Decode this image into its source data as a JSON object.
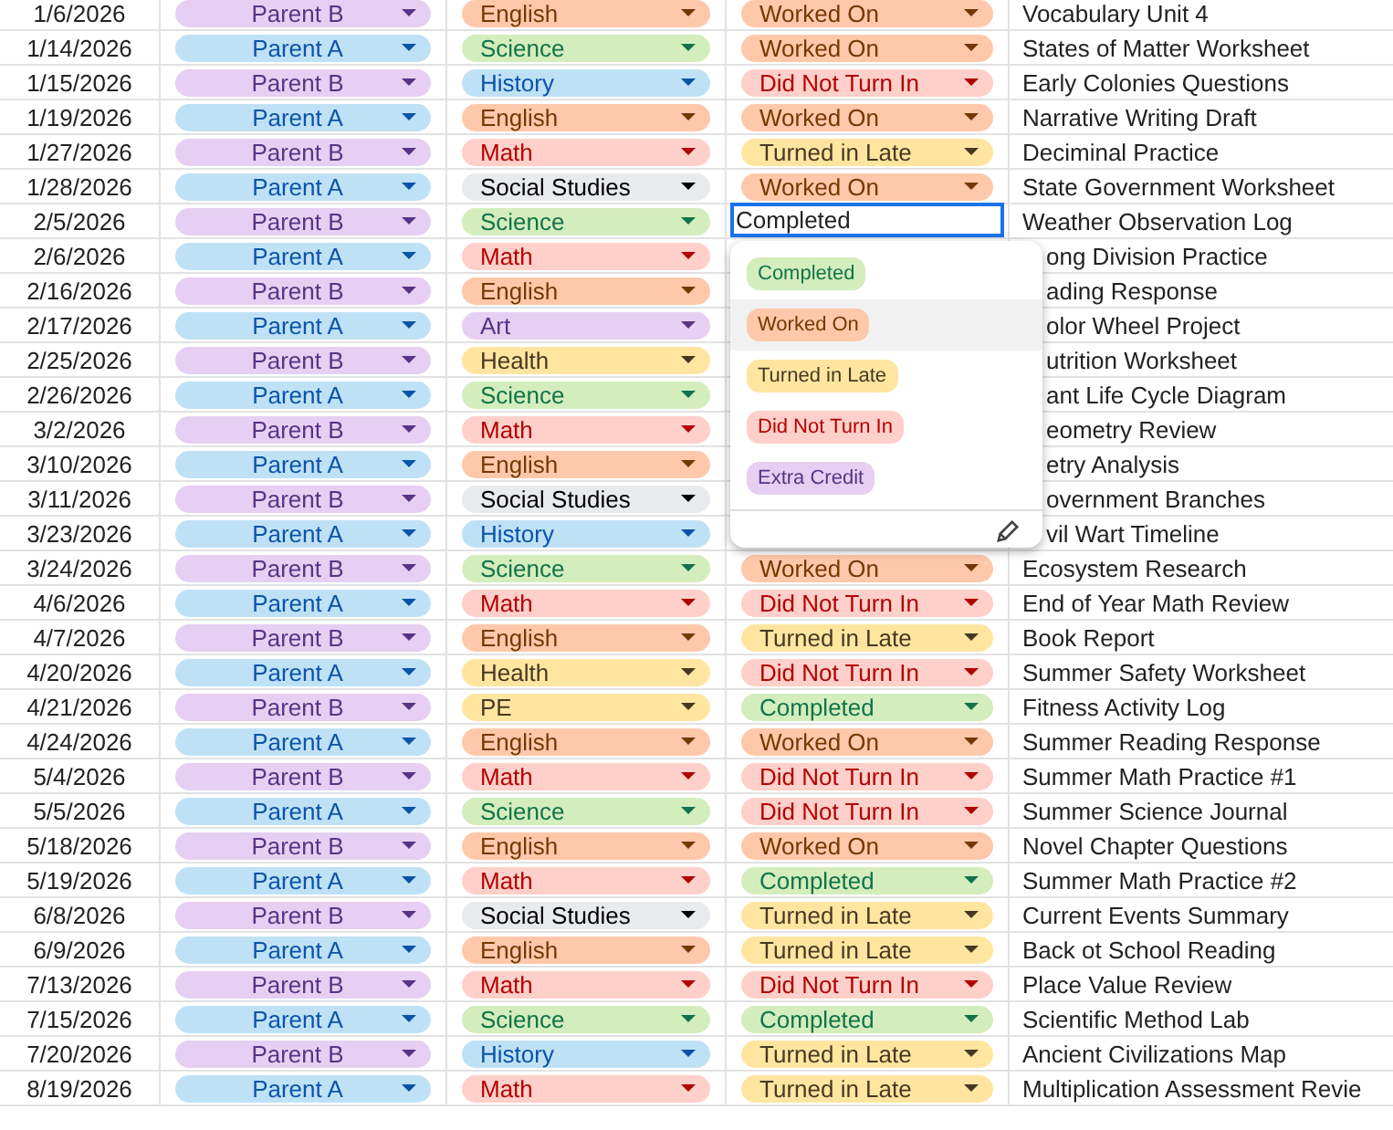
{
  "rows": [
    {
      "date": "1/6/2026",
      "parent": {
        "text": "Parent B",
        "color": "#e6cff2"
      },
      "subject": {
        "text": "English",
        "color": "#ffc8aa"
      },
      "status": {
        "kind": "chip",
        "text": "Worked On",
        "color": "#ffc8aa"
      },
      "title": "Vocabulary Unit 4"
    },
    {
      "date": "1/14/2026",
      "parent": {
        "text": "Parent A",
        "color": "#bfe1f6"
      },
      "subject": {
        "text": "Science",
        "color": "#d4edbc"
      },
      "status": {
        "kind": "chip",
        "text": "Worked On",
        "color": "#ffc8aa"
      },
      "title": "States of Matter Worksheet"
    },
    {
      "date": "1/15/2026",
      "parent": {
        "text": "Parent B",
        "color": "#e6cff2"
      },
      "subject": {
        "text": "History",
        "color": "#bfe1f6"
      },
      "status": {
        "kind": "chip",
        "text": "Did Not Turn In",
        "color": "#ffcfc9"
      },
      "title": "Early Colonies Questions"
    },
    {
      "date": "1/19/2026",
      "parent": {
        "text": "Parent A",
        "color": "#bfe1f6"
      },
      "subject": {
        "text": "English",
        "color": "#ffc8aa"
      },
      "status": {
        "kind": "chip",
        "text": "Worked On",
        "color": "#ffc8aa"
      },
      "title": "Narrative Writing Draft"
    },
    {
      "date": "1/27/2026",
      "parent": {
        "text": "Parent B",
        "color": "#e6cff2"
      },
      "subject": {
        "text": "Math",
        "color": "#ffcfc9"
      },
      "status": {
        "kind": "chip",
        "text": "Turned in Late",
        "color": "#ffe5a0"
      },
      "title": "Deciminal Practice"
    },
    {
      "date": "1/28/2026",
      "parent": {
        "text": "Parent A",
        "color": "#bfe1f6"
      },
      "subject": {
        "text": "Social Studies",
        "color": "#e8eaed"
      },
      "status": {
        "kind": "chip",
        "text": "Worked On",
        "color": "#ffc8aa"
      },
      "title": "State Government Worksheet"
    },
    {
      "date": "2/5/2026",
      "parent": {
        "text": "Parent B",
        "color": "#e6cff2"
      },
      "subject": {
        "text": "Science",
        "color": "#d4edbc"
      },
      "status": {
        "kind": "input",
        "text": "Completed"
      },
      "title": "Weather Observation Log"
    },
    {
      "date": "2/6/2026",
      "parent": {
        "text": "Parent A",
        "color": "#bfe1f6"
      },
      "subject": {
        "text": "Math",
        "color": "#ffcfc9"
      },
      "title": "ong Division Practice"
    },
    {
      "date": "2/16/2026",
      "parent": {
        "text": "Parent B",
        "color": "#e6cff2"
      },
      "subject": {
        "text": "English",
        "color": "#ffc8aa"
      },
      "title": "ading Response"
    },
    {
      "date": "2/17/2026",
      "parent": {
        "text": "Parent A",
        "color": "#bfe1f6"
      },
      "subject": {
        "text": "Art",
        "color": "#e6cff2"
      },
      "title": "olor Wheel Project"
    },
    {
      "date": "2/25/2026",
      "parent": {
        "text": "Parent B",
        "color": "#e6cff2"
      },
      "subject": {
        "text": "Health",
        "color": "#ffe5a0"
      },
      "title": "utrition Worksheet"
    },
    {
      "date": "2/26/2026",
      "parent": {
        "text": "Parent A",
        "color": "#bfe1f6"
      },
      "subject": {
        "text": "Science",
        "color": "#d4edbc"
      },
      "title": "ant Life Cycle Diagram"
    },
    {
      "date": "3/2/2026",
      "parent": {
        "text": "Parent B",
        "color": "#e6cff2"
      },
      "subject": {
        "text": "Math",
        "color": "#ffcfc9"
      },
      "title": "eometry Review"
    },
    {
      "date": "3/10/2026",
      "parent": {
        "text": "Parent A",
        "color": "#bfe1f6"
      },
      "subject": {
        "text": "English",
        "color": "#ffc8aa"
      },
      "title": "etry Analysis"
    },
    {
      "date": "3/11/2026",
      "parent": {
        "text": "Parent B",
        "color": "#e6cff2"
      },
      "subject": {
        "text": "Social Studies",
        "color": "#e8eaed"
      },
      "title": "overnment Branches"
    },
    {
      "date": "3/23/2026",
      "parent": {
        "text": "Parent A",
        "color": "#bfe1f6"
      },
      "subject": {
        "text": "History",
        "color": "#bfe1f6"
      },
      "title": "vil Wart Timeline"
    },
    {
      "date": "3/24/2026",
      "parent": {
        "text": "Parent B",
        "color": "#e6cff2"
      },
      "subject": {
        "text": "Science",
        "color": "#d4edbc"
      },
      "status": {
        "kind": "chip",
        "text": "Worked On",
        "color": "#ffc8aa"
      },
      "title": "Ecosystem Research"
    },
    {
      "date": "4/6/2026",
      "parent": {
        "text": "Parent A",
        "color": "#bfe1f6"
      },
      "subject": {
        "text": "Math",
        "color": "#ffcfc9"
      },
      "status": {
        "kind": "chip",
        "text": "Did Not Turn In",
        "color": "#ffcfc9"
      },
      "title": "End of Year Math Review"
    },
    {
      "date": "4/7/2026",
      "parent": {
        "text": "Parent B",
        "color": "#e6cff2"
      },
      "subject": {
        "text": "English",
        "color": "#ffc8aa"
      },
      "status": {
        "kind": "chip",
        "text": "Turned in Late",
        "color": "#ffe5a0"
      },
      "title": "Book Report"
    },
    {
      "date": "4/20/2026",
      "parent": {
        "text": "Parent A",
        "color": "#bfe1f6"
      },
      "subject": {
        "text": "Health",
        "color": "#ffe5a0"
      },
      "status": {
        "kind": "chip",
        "text": "Did Not Turn In",
        "color": "#ffcfc9"
      },
      "title": "Summer Safety Worksheet"
    },
    {
      "date": "4/21/2026",
      "parent": {
        "text": "Parent B",
        "color": "#e6cff2"
      },
      "subject": {
        "text": "PE",
        "color": "#ffe5a0"
      },
      "status": {
        "kind": "chip",
        "text": "Completed",
        "color": "#d4edbc"
      },
      "title": "Fitness Activity Log"
    },
    {
      "date": "4/24/2026",
      "parent": {
        "text": "Parent A",
        "color": "#bfe1f6"
      },
      "subject": {
        "text": "English",
        "color": "#ffc8aa"
      },
      "status": {
        "kind": "chip",
        "text": "Worked On",
        "color": "#ffc8aa"
      },
      "title": "Summer Reading Response"
    },
    {
      "date": "5/4/2026",
      "parent": {
        "text": "Parent B",
        "color": "#e6cff2"
      },
      "subject": {
        "text": "Math",
        "color": "#ffcfc9"
      },
      "status": {
        "kind": "chip",
        "text": "Did Not Turn In",
        "color": "#ffcfc9"
      },
      "title": "Summer Math Practice #1"
    },
    {
      "date": "5/5/2026",
      "parent": {
        "text": "Parent A",
        "color": "#bfe1f6"
      },
      "subject": {
        "text": "Science",
        "color": "#d4edbc"
      },
      "status": {
        "kind": "chip",
        "text": "Did Not Turn In",
        "color": "#ffcfc9"
      },
      "title": "Summer Science Journal"
    },
    {
      "date": "5/18/2026",
      "parent": {
        "text": "Parent B",
        "color": "#e6cff2"
      },
      "subject": {
        "text": "English",
        "color": "#ffc8aa"
      },
      "status": {
        "kind": "chip",
        "text": "Worked On",
        "color": "#ffc8aa"
      },
      "title": "Novel Chapter Questions"
    },
    {
      "date": "5/19/2026",
      "parent": {
        "text": "Parent A",
        "color": "#bfe1f6"
      },
      "subject": {
        "text": "Math",
        "color": "#ffcfc9"
      },
      "status": {
        "kind": "chip",
        "text": "Completed",
        "color": "#d4edbc"
      },
      "title": "Summer Math Practice #2"
    },
    {
      "date": "6/8/2026",
      "parent": {
        "text": "Parent B",
        "color": "#e6cff2"
      },
      "subject": {
        "text": "Social Studies",
        "color": "#e8eaed"
      },
      "status": {
        "kind": "chip",
        "text": "Turned in Late",
        "color": "#ffe5a0"
      },
      "title": "Current Events Summary"
    },
    {
      "date": "6/9/2026",
      "parent": {
        "text": "Parent A",
        "color": "#bfe1f6"
      },
      "subject": {
        "text": "English",
        "color": "#ffc8aa"
      },
      "status": {
        "kind": "chip",
        "text": "Turned in Late",
        "color": "#ffe5a0"
      },
      "title": "Back ot School Reading"
    },
    {
      "date": "7/13/2026",
      "parent": {
        "text": "Parent B",
        "color": "#e6cff2"
      },
      "subject": {
        "text": "Math",
        "color": "#ffcfc9"
      },
      "status": {
        "kind": "chip",
        "text": "Did Not Turn In",
        "color": "#ffcfc9"
      },
      "title": "Place Value Review"
    },
    {
      "date": "7/15/2026",
      "parent": {
        "text": "Parent A",
        "color": "#bfe1f6"
      },
      "subject": {
        "text": "Science",
        "color": "#d4edbc"
      },
      "status": {
        "kind": "chip",
        "text": "Completed",
        "color": "#d4edbc"
      },
      "title": "Scientific Method Lab"
    },
    {
      "date": "7/20/2026",
      "parent": {
        "text": "Parent B",
        "color": "#e6cff2"
      },
      "subject": {
        "text": "History",
        "color": "#bfe1f6"
      },
      "status": {
        "kind": "chip",
        "text": "Turned in Late",
        "color": "#ffe5a0"
      },
      "title": "Ancient Civilizations Map"
    },
    {
      "date": "8/19/2026",
      "parent": {
        "text": "Parent A",
        "color": "#bfe1f6"
      },
      "subject": {
        "text": "Math",
        "color": "#ffcfc9"
      },
      "status": {
        "kind": "chip",
        "text": "Turned in Late",
        "color": "#ffe5a0"
      },
      "title": "Multiplication Assessment Revie"
    }
  ],
  "status_menu": {
    "options": [
      {
        "text": "Completed",
        "color": "#d4edbc",
        "highlighted": false
      },
      {
        "text": "Worked On",
        "color": "#ffc8aa",
        "highlighted": true
      },
      {
        "text": "Turned in Late",
        "color": "#ffe5a0",
        "highlighted": false
      },
      {
        "text": "Did Not Turn In",
        "color": "#ffcfc9",
        "highlighted": false
      },
      {
        "text": "Extra Credit",
        "color": "#e6cff2",
        "highlighted": false
      }
    ]
  }
}
